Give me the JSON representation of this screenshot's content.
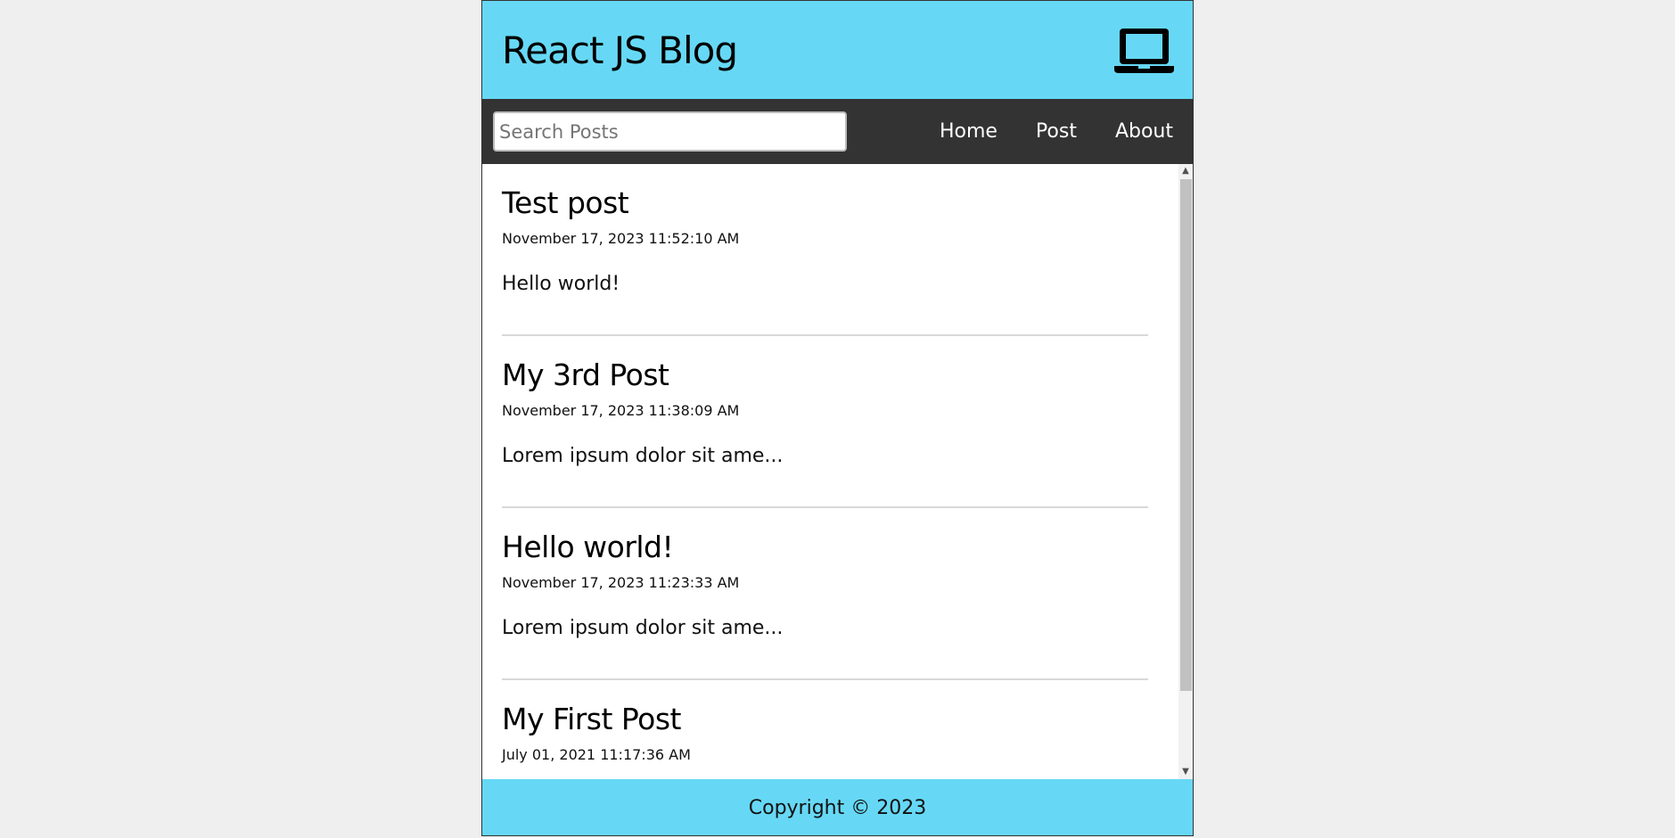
{
  "header": {
    "title": "React JS Blog",
    "icon": "laptop-icon"
  },
  "nav": {
    "search_placeholder": "Search Posts",
    "search_value": "",
    "links": [
      {
        "label": "Home"
      },
      {
        "label": "Post"
      },
      {
        "label": "About"
      }
    ]
  },
  "posts": [
    {
      "title": "Test post",
      "date": "November 17, 2023 11:52:10 AM",
      "body": "Hello world!"
    },
    {
      "title": "My 3rd Post",
      "date": "November 17, 2023 11:38:09 AM",
      "body": "Lorem ipsum dolor sit ame..."
    },
    {
      "title": "Hello world!",
      "date": "November 17, 2023 11:23:33 AM",
      "body": "Lorem ipsum dolor sit ame..."
    },
    {
      "title": "My First Post",
      "date": "July 01, 2021 11:17:36 AM",
      "body": ""
    }
  ],
  "footer": {
    "copyright": "Copyright © 2023"
  },
  "colors": {
    "header_bg": "#66d8f5",
    "nav_bg": "#333333",
    "page_bg": "#efefef"
  }
}
